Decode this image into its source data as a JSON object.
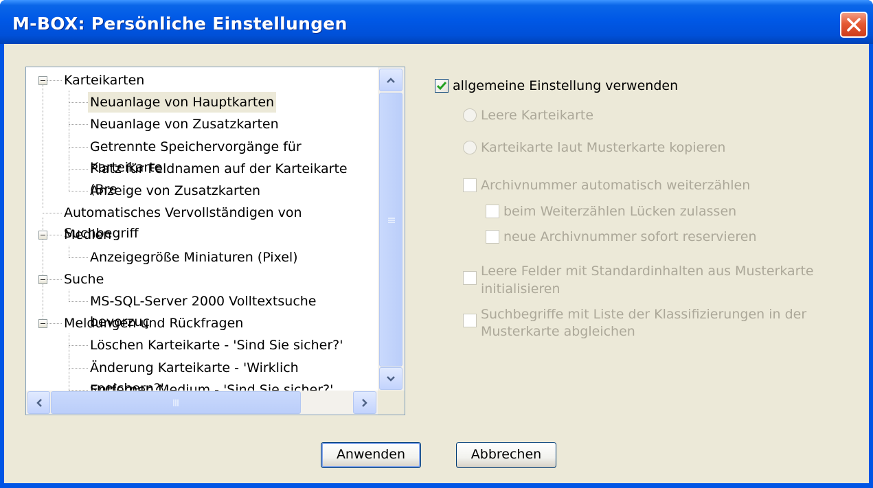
{
  "window": {
    "title": "M-BOX: Persönliche Einstellungen",
    "close_icon": "close-x-icon"
  },
  "tree": {
    "items": [
      {
        "label": "Karteikarten",
        "level": 0,
        "expanded": true
      },
      {
        "label": "Neuanlage von Hauptkarten",
        "level": 1,
        "selected": true
      },
      {
        "label": "Neuanlage von Zusatzkarten",
        "level": 1
      },
      {
        "label": "Getrennte Speichervorgänge für Karteikarte",
        "level": 1
      },
      {
        "label": "Platz für Feldnamen auf der Karteikarte (Bre",
        "level": 1
      },
      {
        "label": "Anzeige von Zusatzkarten",
        "level": 1
      },
      {
        "label": "Automatisches Vervollständigen von Suchbegriff",
        "level": 0
      },
      {
        "label": "Medien",
        "level": 0,
        "expanded": true
      },
      {
        "label": "Anzeigegröße Miniaturen (Pixel)",
        "level": 1
      },
      {
        "label": "Suche",
        "level": 0,
        "expanded": true
      },
      {
        "label": "MS-SQL-Server 2000 Volltextsuche bevorzuç",
        "level": 1
      },
      {
        "label": "Meldungen und Rückfragen",
        "level": 0,
        "expanded": true
      },
      {
        "label": "Löschen Karteikarte - 'Sind Sie sicher?'",
        "level": 1
      },
      {
        "label": "Änderung Karteikarte - 'Wirklich speichern?'",
        "level": 1
      },
      {
        "label": "Entfernen Medium - 'Sind Sie sicher?'",
        "level": 1
      }
    ]
  },
  "options": {
    "general": {
      "label": "allgemeine Einstellung verwenden",
      "checked": true
    },
    "radio_empty": {
      "label": "Leere Karteikarte",
      "checked": false
    },
    "radio_copy": {
      "label": "Karteikarte laut Musterkarte kopieren",
      "checked": false
    },
    "archiv_auto": {
      "label": "Archivnummer automatisch weiterzählen",
      "checked": false
    },
    "gaps": {
      "label": "beim Weiterzählen Lücken zulassen",
      "checked": false
    },
    "reserve": {
      "label": "neue Archivnummer sofort reservieren",
      "checked": false
    },
    "empty_fields": {
      "line1": "Leere Felder mit Standardinhalten aus Musterkarte",
      "line2": "initialisieren",
      "checked": false
    },
    "keywords": {
      "line1": "Suchbegriffe mit Liste der Klassifizierungen in der",
      "line2": "Musterkarte abgleichen",
      "checked": false
    }
  },
  "buttons": {
    "apply": "Anwenden",
    "cancel": "Abbrechen"
  },
  "icons": {
    "collapse": "minus-box-icon",
    "scroll_up": "chevron-up-icon",
    "scroll_down": "chevron-down-icon",
    "scroll_left": "chevron-left-icon",
    "scroll_right": "chevron-right-icon",
    "grip": "grip-icon"
  },
  "colors": {
    "titlebar": "#0055E5",
    "dialog_bg": "#ECE9D8",
    "disabled_text": "#ACA899",
    "check": "#21A121",
    "close": "#E0502A"
  }
}
